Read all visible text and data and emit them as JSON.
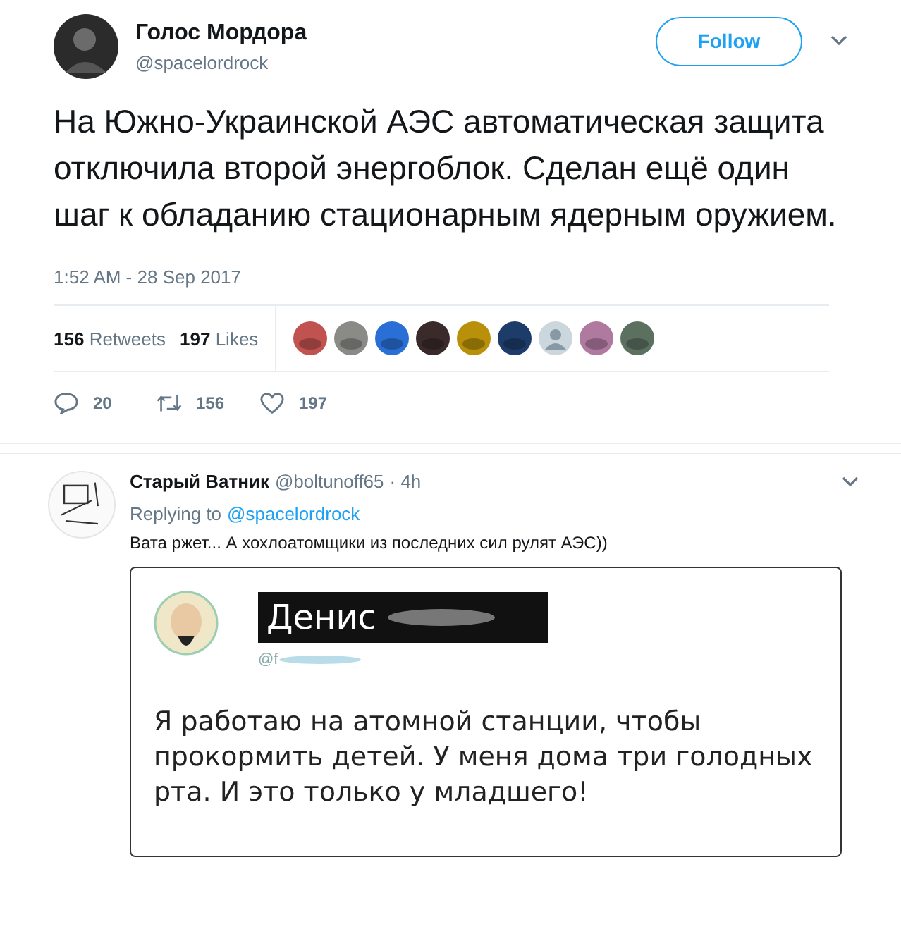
{
  "tweet": {
    "author_name": "Голос Мордора",
    "author_handle": "@spacelordrock",
    "follow_button": "Follow",
    "text": "На Южно-Украинской АЭС автоматическая защита отключила второй энергоблок. Сделан ещё один шаг к обладанию стационарным ядерным оружием.",
    "timestamp": "1:52 AM - 28 Sep 2017",
    "stats": [
      {
        "count": "156",
        "label": "Retweets"
      },
      {
        "count": "197",
        "label": "Likes"
      }
    ],
    "likers": [
      {
        "kind": "photo"
      },
      {
        "kind": "photo"
      },
      {
        "kind": "photo"
      },
      {
        "kind": "photo"
      },
      {
        "kind": "photo"
      },
      {
        "kind": "photo"
      },
      {
        "kind": "default"
      },
      {
        "kind": "photo"
      },
      {
        "kind": "photo"
      }
    ],
    "actions": [
      {
        "kind": "reply",
        "count": "20"
      },
      {
        "kind": "retweet",
        "count": "156"
      },
      {
        "kind": "like",
        "count": "197"
      }
    ]
  },
  "reply": {
    "author_name": "Старый Ватник",
    "author_handle": "@boltunoff65",
    "time": "· 4h",
    "replying_label": "Replying to",
    "replying_to": "@spacelordrock",
    "text": "Вата ржет... А хохлоатомщики из последних сил рулят АЭС))",
    "attached_screenshot": {
      "name": "Денис",
      "handle": "@f",
      "text": "Я работаю на атомной станции, чтобы прокормить детей. У меня дома три голодных рта. И это только у младшего!"
    }
  }
}
